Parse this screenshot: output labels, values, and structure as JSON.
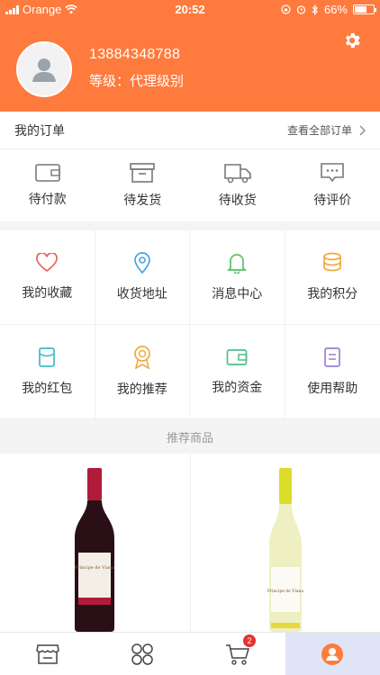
{
  "status_bar": {
    "carrier": "Orange",
    "time": "20:52",
    "battery": "66%"
  },
  "profile": {
    "phone": "13884348788",
    "level": "等级：代理级别"
  },
  "orders": {
    "title": "我的订单",
    "view_all": "查看全部订单",
    "items": [
      {
        "label": "待付款",
        "icon": "wallet-icon"
      },
      {
        "label": "待发货",
        "icon": "box-icon"
      },
      {
        "label": "待收货",
        "icon": "truck-icon"
      },
      {
        "label": "待评价",
        "icon": "comment-icon"
      }
    ]
  },
  "services": {
    "items": [
      {
        "label": "我的收藏",
        "icon": "heart-icon",
        "color": "#e8625b"
      },
      {
        "label": "收货地址",
        "icon": "location-icon",
        "color": "#4aa3e0"
      },
      {
        "label": "消息中心",
        "icon": "bell-icon",
        "color": "#5cbf6c"
      },
      {
        "label": "我的积分",
        "icon": "coins-icon",
        "color": "#f0a93b"
      },
      {
        "label": "我的红包",
        "icon": "red-packet-icon",
        "color": "#3cbcc6"
      },
      {
        "label": "我的推荐",
        "icon": "medal-icon",
        "color": "#f0a93b"
      },
      {
        "label": "我的资金",
        "icon": "wallet-icon",
        "color": "#4cc08a"
      },
      {
        "label": "使用帮助",
        "icon": "help-book-icon",
        "color": "#9b7fd6"
      }
    ]
  },
  "recommend": {
    "title": "推荐商品"
  },
  "products": [
    {
      "name": "red-wine-bottle",
      "label": "Principe de Viana"
    },
    {
      "name": "white-wine-bottle",
      "label": "Principe de Viana"
    }
  ],
  "tabbar": {
    "items": [
      {
        "icon": "store-icon"
      },
      {
        "icon": "category-icon"
      },
      {
        "icon": "cart-icon",
        "badge": "2"
      },
      {
        "icon": "user-icon",
        "active": true
      }
    ]
  },
  "colors": {
    "brand": "#ff7a3d",
    "badge": "#e63232",
    "active_tab": "#dfe5f7"
  }
}
